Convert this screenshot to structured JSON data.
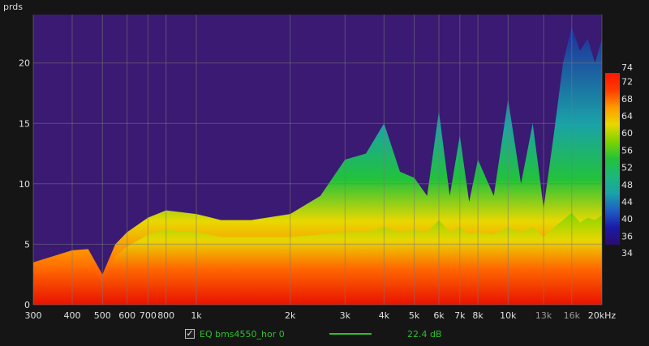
{
  "chart_data": {
    "type": "heatmap",
    "title": "",
    "ylabel": "prds",
    "xlabel": "",
    "x_scale": "log",
    "xlim": [
      300,
      20000
    ],
    "ylim": [
      0,
      24
    ],
    "x_ticks": [
      300,
      400,
      500,
      600,
      700,
      800,
      1000,
      2000,
      3000,
      4000,
      5000,
      6000,
      7000,
      8000,
      10000,
      13000,
      16000,
      20000
    ],
    "x_tick_labels": [
      "300",
      "400",
      "500",
      "600",
      "700",
      "800",
      "1k",
      "2k",
      "3k",
      "4k",
      "5k",
      "6k",
      "7k",
      "8k",
      "10k",
      "13k",
      "16k",
      "20kHz"
    ],
    "y_ticks": [
      0,
      5,
      10,
      15,
      20
    ],
    "y_tick_labels": [
      "0",
      "5",
      "10",
      "15",
      "20"
    ],
    "colorbar": {
      "min": 34,
      "max": 74,
      "ticks": [
        74,
        72,
        68,
        64,
        60,
        56,
        52,
        48,
        44,
        40,
        36,
        34
      ],
      "tick_labels": [
        "74",
        "72",
        "68",
        "64",
        "60",
        "56",
        "52",
        "48",
        "44",
        "40",
        "36",
        "34"
      ]
    },
    "background_color": "#3a1a72",
    "grid": true,
    "legend_placement": "bottom",
    "series": [
      {
        "name": "EQ bms4550_hor 0",
        "color": "#2fbf2f",
        "value_label": "22.4 dB"
      }
    ],
    "surface": {
      "description_values": "peak decay time in periods per frequency",
      "x": [
        300,
        400,
        450,
        500,
        550,
        600,
        700,
        800,
        1000,
        1200,
        1500,
        2000,
        2500,
        3000,
        3500,
        4000,
        4500,
        5000,
        5500,
        6000,
        6500,
        7000,
        7500,
        8000,
        9000,
        10000,
        11000,
        12000,
        13000,
        14000,
        15000,
        16000,
        17000,
        18000,
        19000,
        20000
      ],
      "top_y": [
        3.5,
        4.5,
        4.6,
        2.5,
        5.0,
        6.0,
        7.2,
        7.8,
        7.5,
        7.0,
        7.0,
        7.5,
        9.0,
        12.0,
        12.5,
        15.0,
        11.0,
        10.5,
        9.0,
        16.0,
        9.0,
        14.0,
        8.5,
        12.0,
        9.0,
        17.0,
        10.0,
        15.0,
        8.0,
        14.0,
        20.0,
        23.0,
        21.0,
        22.0,
        20.0,
        22.0
      ],
      "band_y": [
        2.5,
        3.2,
        3.4,
        1.8,
        4.0,
        4.8,
        5.8,
        6.2,
        6.0,
        5.6,
        5.6,
        5.6,
        5.8,
        6.0,
        6.0,
        6.4,
        6.0,
        6.2,
        6.0,
        7.0,
        6.0,
        6.4,
        5.8,
        6.0,
        5.8,
        6.4,
        6.0,
        6.4,
        5.6,
        6.4,
        7.0,
        7.6,
        6.8,
        7.2,
        7.0,
        7.4
      ]
    }
  }
}
